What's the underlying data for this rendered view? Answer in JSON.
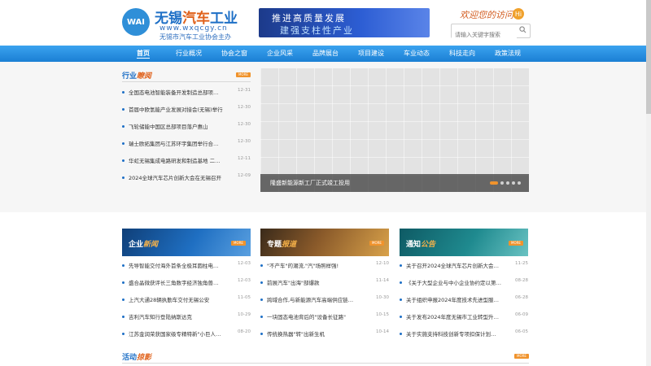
{
  "header": {
    "logo_badge": "WAI",
    "logo_title_a": "无锡",
    "logo_title_b": "汽车",
    "logo_title_c": "工业",
    "logo_url": "www.wxqcgy.cn",
    "logo_sub": "无锡市汽车工业协会主办",
    "banner_line1": "推进高质量发展",
    "banner_line2": "建强支柱性产业",
    "welcome": "欢迎您的访问!",
    "hi": "Hi",
    "search_placeholder": "请输入关键字搜索"
  },
  "nav": {
    "items": [
      "首页",
      "行业概况",
      "协会之窗",
      "企业风采",
      "品牌展台",
      "项目建设",
      "车业动态",
      "科技走向",
      "政策法规"
    ],
    "active_index": 0
  },
  "industry_news": {
    "title_a": "行业",
    "title_b": "瞭阅",
    "more": "MORE",
    "items": [
      {
        "title": "全国态电池智能装备开发制造总部项…",
        "date": "12-31"
      },
      {
        "title": "首届中欧氢能产业发展对接会(无锡)举行",
        "date": "12-30"
      },
      {
        "title": "飞轮储能中国区总部项目落户惠山",
        "date": "12-30"
      },
      {
        "title": "瑞士欧拓集团与江苏环宇集团举行合…",
        "date": "12-30"
      },
      {
        "title": "华虹无锡集成电路研发和制造基地 二…",
        "date": "12-11"
      },
      {
        "title": "2024全球汽车芯片创新大会在无锡召开",
        "date": "12-09"
      }
    ]
  },
  "slider": {
    "caption": "隆盛新能源新工厂正式竣工投用",
    "dot_count": 5,
    "active_dot": 0
  },
  "cards": [
    {
      "title_a": "企业",
      "title_b": "新闻",
      "more": "MORE",
      "items": [
        {
          "title": "先导智能交付海外首条全极耳圆柱电…",
          "date": "12-03"
        },
        {
          "title": "盛合晶微获评长三角数字经济独角兽…",
          "date": "12-03"
        },
        {
          "title": "上汽大通28辆执勤车交付无锡公安",
          "date": "11-05"
        },
        {
          "title": "吉利汽车知行登陆纳斯达克",
          "date": "10-29"
        },
        {
          "title": "江苏金润荣获国家级专精特新\"小巨人…",
          "date": "08-20"
        }
      ]
    },
    {
      "title_a": "专题",
      "title_b": "报道",
      "more": "MORE",
      "items": [
        {
          "title": "\"不产车\"的潮流,\"汽\"场照样强!",
          "date": "12-10"
        },
        {
          "title": "前展汽车\"出海\"部爆款",
          "date": "11-14"
        },
        {
          "title": "跨域合作,与新能源汽车高端供应链…",
          "date": "10-30"
        },
        {
          "title": "一块固态电池背后的\"设备长征路\"",
          "date": "10-15"
        },
        {
          "title": "传统换热器\"转\"出新生机",
          "date": "10-14"
        }
      ]
    },
    {
      "title_a": "通知",
      "title_b": "公告",
      "more": "MORE",
      "items": [
        {
          "title": "关于召开2024全球汽车芯片创新大会…",
          "date": "11-25"
        },
        {
          "title": "《关于大型企业与中小企业协约定以第…",
          "date": "08-28"
        },
        {
          "title": "关于组织申报2024年度技术先进型服…",
          "date": "06-28"
        },
        {
          "title": "关于发布2024年度无锡市工业转型升…",
          "date": "06-09"
        },
        {
          "title": "关于实施支持科技创新专项扣保计划…",
          "date": "06-05"
        }
      ]
    }
  ],
  "activities": {
    "title_a": "活动",
    "title_b": "掠影",
    "more": "MORE"
  }
}
